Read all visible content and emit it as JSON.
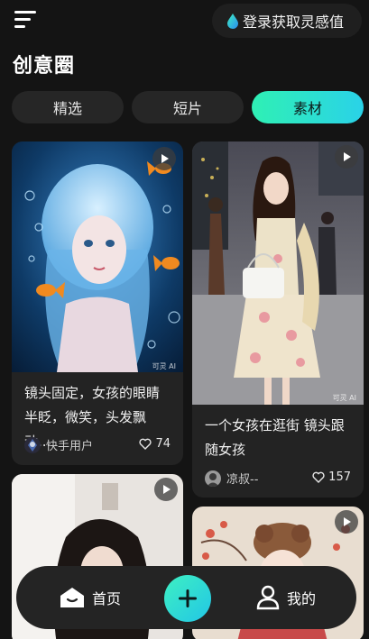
{
  "header": {
    "login_label": "登录获取灵感值",
    "title": "创意圈"
  },
  "tabs": [
    {
      "label": "精选",
      "active": false
    },
    {
      "label": "短片",
      "active": false
    },
    {
      "label": "素材",
      "active": true
    }
  ],
  "cards": [
    {
      "title": "镜头固定，女孩的眼睛半眨，微笑，头发飘动...",
      "author": "快手用户",
      "likes": "74",
      "watermark": "可灵 AI"
    },
    {
      "title": "一个女孩在逛街 镜头跟随女孩",
      "author": "凉叔--",
      "likes": "157",
      "watermark": "可灵 AI"
    },
    {
      "title": "",
      "author": "",
      "likes": ""
    },
    {
      "title": "",
      "author": "",
      "likes": ""
    }
  ],
  "bottom_nav": {
    "home_label": "首页",
    "me_label": "我的"
  },
  "colors": {
    "accent_start": "#2ff0b4",
    "accent_end": "#2ad2e8",
    "background": "#141414",
    "card": "#232323"
  },
  "icons": [
    "menu-icon",
    "drop-icon",
    "play-icon",
    "heart-icon",
    "home-icon",
    "plus-icon",
    "profile-icon"
  ]
}
